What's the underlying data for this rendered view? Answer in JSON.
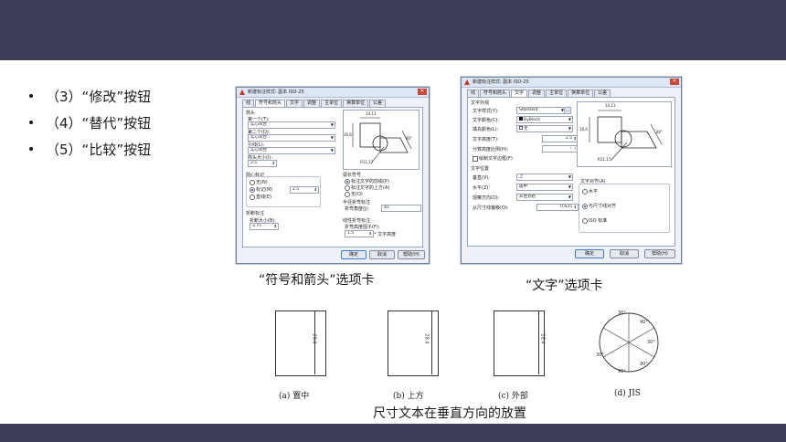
{
  "bullets": [
    "（3）“修改”按钮",
    "（4）“替代”按钮",
    "（5）“比较”按钮"
  ],
  "captions": {
    "left_dialog": "“符号和箭头”选项卡",
    "right_dialog": "“文字”选项卡",
    "bottom": "尺寸文本在垂直方向的放置"
  },
  "dialog1": {
    "title": "新建标注样式: 副本 ISO-25",
    "tabs": [
      "线",
      "符号和箭头",
      "文字",
      "调整",
      "主单位",
      "换算单位",
      "公差"
    ],
    "active_tab": "符号和箭头",
    "labels": {
      "arrow": "箭头",
      "first": "第一个(T):",
      "second": "第二个(D):",
      "leader": "引线(L):",
      "arrow_size": "箭头大小(I):",
      "center_mark": "圆心标记",
      "cm_none": "无(N)",
      "cm_mark": "标记(M)",
      "cm_line": "直线(E)",
      "break": "折断标注",
      "break_size": "折断大小(B):",
      "arc_symbol": "弧长符号",
      "arc_prefix": "标注文字的前缀(P)",
      "arc_above": "标注文字的上方(A)",
      "arc_none": "无(O)",
      "jog_radius": "半径折弯标注",
      "jog_angle": "折弯角度(J):",
      "jog_linear": "线性折弯标注",
      "jog_factor": "折弯高度因子(F):",
      "text_height": "* 文字高度"
    },
    "values": {
      "first": "实心闭合",
      "second": "实心闭合",
      "leader": "实心闭合",
      "arrow_size": "2.5",
      "mark_size": "2.5",
      "break_size": "3.75",
      "jog_angle": "45",
      "jog_factor": "1.5"
    },
    "preview_dims": [
      "14,11",
      "16,6",
      "80°",
      "R11,17"
    ],
    "buttons": [
      "确定",
      "取消",
      "帮助(H)"
    ]
  },
  "dialog2": {
    "title": "新建标注样式: 副本 ISO-25",
    "tabs": [
      "线",
      "符号和箭头",
      "文字",
      "调整",
      "主单位",
      "换算单位",
      "公差"
    ],
    "active_tab": "文字",
    "labels": {
      "appearance": "文字外观",
      "style": "文字样式(Y):",
      "color": "文字颜色(C):",
      "fill": "填充颜色(L):",
      "height": "文字高度(T):",
      "fraction": "分数高度比例(H):",
      "frame": "绘制文字边框(F)",
      "placement": "文字位置",
      "vertical": "垂直(V):",
      "horizontal": "水平(Z):",
      "view_dir": "观察方向(D):",
      "offset": "从尺寸线偏移(O):",
      "alignment": "文字对齐(A)",
      "al_horizontal": "水平",
      "al_aligned": "与尺寸线对齐",
      "al_iso": "ISO 标准"
    },
    "values": {
      "style": "Standard",
      "color": "ByBlock",
      "fill": "无",
      "height": "2.5",
      "fraction": "1",
      "vertical": "上",
      "horizontal": "居中",
      "view_dir": "从左到右",
      "offset": "0.625"
    },
    "preview_dims": [
      "14,11",
      "16,6",
      "80°",
      "R11,17"
    ],
    "buttons": [
      "确定",
      "取消",
      "帮助(H)"
    ]
  },
  "examples": [
    {
      "label": "(a) 置中",
      "dim": "28.4"
    },
    {
      "label": "(b) 上方",
      "dim": "28.4"
    },
    {
      "label": "(c) 外部",
      "dim": "28.4"
    },
    {
      "label": "(d) JIS",
      "dims": [
        "30°",
        "90°",
        "30°",
        "90°",
        "90°",
        "30°"
      ]
    }
  ],
  "colors": {
    "bar": "#3c3d57",
    "dialog_bg": "#eef2f8"
  }
}
